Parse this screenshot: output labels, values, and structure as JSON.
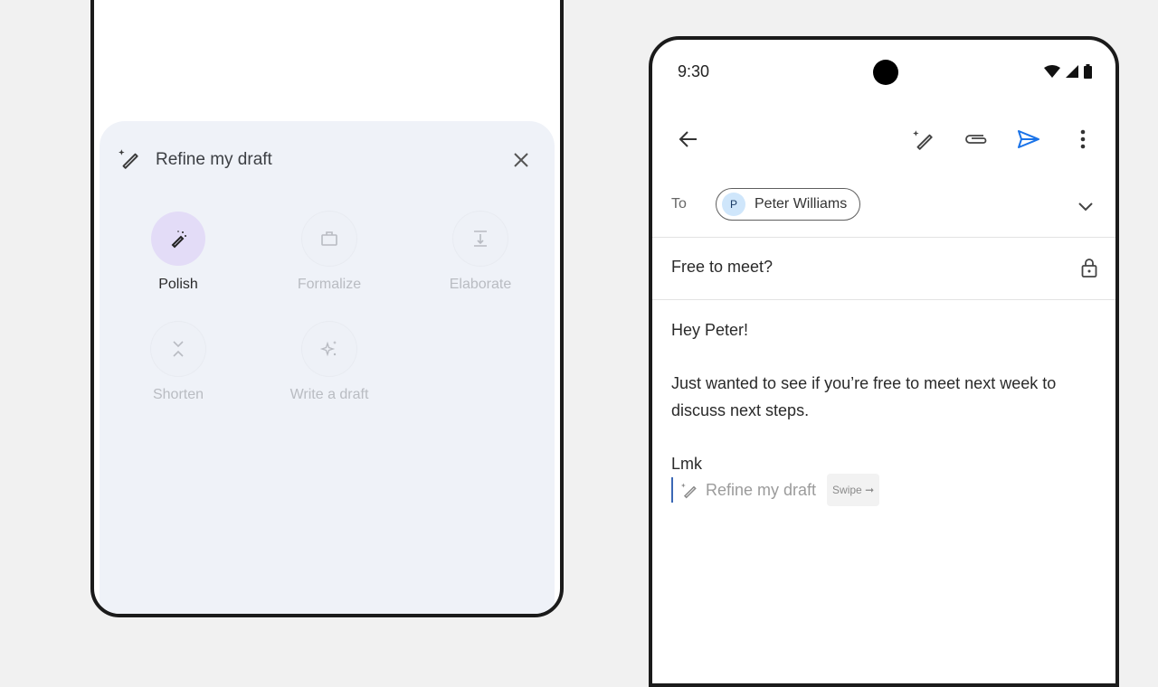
{
  "left_phone": {
    "sheet": {
      "title": "Refine my draft",
      "title_icon": "magic-pen-icon",
      "close_icon": "close-icon",
      "options": [
        {
          "label": "Polish",
          "icon": "magic-wand-icon",
          "active": true
        },
        {
          "label": "Formalize",
          "icon": "briefcase-icon",
          "active": false
        },
        {
          "label": "Elaborate",
          "icon": "expand-vertical-icon",
          "active": false
        },
        {
          "label": "Shorten",
          "icon": "collapse-vertical-icon",
          "active": false
        },
        {
          "label": "Write a draft",
          "icon": "sparkle-icon",
          "active": false
        }
      ]
    }
  },
  "right_phone": {
    "status_bar": {
      "time": "9:30",
      "icons": [
        "wifi-icon",
        "signal-icon",
        "battery-icon"
      ]
    },
    "toolbar": {
      "back": "back-arrow-icon",
      "actions": [
        "magic-pen-icon",
        "attach-icon",
        "send-icon",
        "more-vert-icon"
      ]
    },
    "to_label": "To",
    "recipient": {
      "initial": "P",
      "name": "Peter Williams"
    },
    "subject": "Free to meet?",
    "body": {
      "greeting": "Hey Peter!",
      "paragraph": "Just wanted to see if you’re free to meet next week to discuss next steps.",
      "signoff": "Lmk"
    },
    "suggestion": {
      "label": "Refine my draft",
      "hint": "Swipe ➞"
    },
    "colors": {
      "accent": "#1a73e8",
      "chip_avatar": "#cfe6fb",
      "active_option": "#e3dcf7"
    }
  }
}
